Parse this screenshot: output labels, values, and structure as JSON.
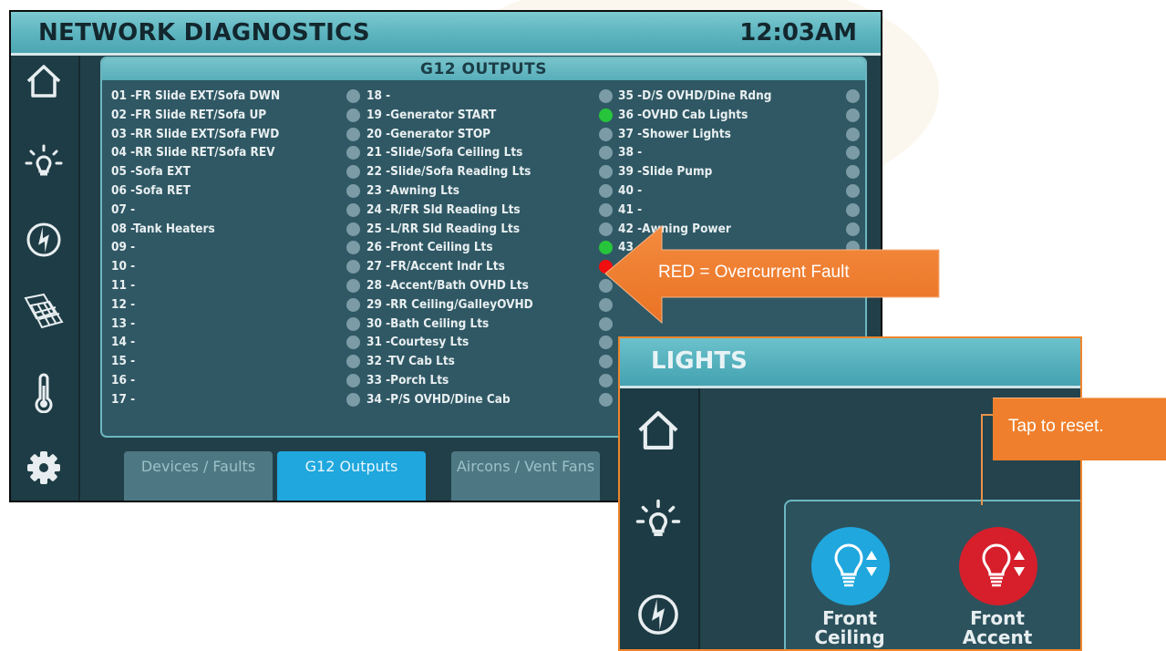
{
  "colors": {
    "accent": "#4ca6b2",
    "active_tab": "#1fa7de",
    "led_off": "#7b9ba6",
    "led_on": "#27c53b",
    "led_fault": "#f10e0e",
    "callout": "#ef7f2c"
  },
  "header": {
    "title": "NETWORK DIAGNOSTICS",
    "time": "12:03AM"
  },
  "sidebar": {
    "items": [
      {
        "icon": "home-icon"
      },
      {
        "icon": "light-bulb-icon"
      },
      {
        "icon": "power-icon"
      },
      {
        "icon": "solar-panel-icon"
      },
      {
        "icon": "thermometer-icon"
      },
      {
        "icon": "gear-icon"
      }
    ]
  },
  "outputs": {
    "title": "G12 OUTPUTS",
    "columns": [
      [
        {
          "label": "01 -FR Slide EXT/Sofa DWN",
          "state": "off"
        },
        {
          "label": "02 -FR Slide RET/Sofa UP",
          "state": "off"
        },
        {
          "label": "03 -RR Slide EXT/Sofa FWD",
          "state": "off"
        },
        {
          "label": "04 -RR Slide RET/Sofa REV",
          "state": "off"
        },
        {
          "label": "05 -Sofa EXT",
          "state": "off"
        },
        {
          "label": "06 -Sofa RET",
          "state": "off"
        },
        {
          "label": "07 -",
          "state": "off"
        },
        {
          "label": "08 -Tank Heaters",
          "state": "off"
        },
        {
          "label": "09 -",
          "state": "off"
        },
        {
          "label": "10 -",
          "state": "off"
        },
        {
          "label": "11 -",
          "state": "off"
        },
        {
          "label": "12 -",
          "state": "off"
        },
        {
          "label": "13 -",
          "state": "off"
        },
        {
          "label": "14 -",
          "state": "off"
        },
        {
          "label": "15 -",
          "state": "off"
        },
        {
          "label": "16 -",
          "state": "off"
        },
        {
          "label": "17 -",
          "state": "off"
        }
      ],
      [
        {
          "label": "18 -",
          "state": "off"
        },
        {
          "label": "19 -Generator START",
          "state": "on"
        },
        {
          "label": "20 -Generator STOP",
          "state": "off"
        },
        {
          "label": "21 -Slide/Sofa Ceiling Lts",
          "state": "off"
        },
        {
          "label": "22 -Slide/Sofa Reading Lts",
          "state": "off"
        },
        {
          "label": "23 -Awning Lts",
          "state": "off"
        },
        {
          "label": "24 -R/FR Sld Reading Lts",
          "state": "off"
        },
        {
          "label": "25 -L/RR Sld Reading Lts",
          "state": "off"
        },
        {
          "label": "26 -Front Ceiling Lts",
          "state": "on"
        },
        {
          "label": "27 -FR/Accent Indr Lts",
          "state": "fault"
        },
        {
          "label": "28 -Accent/Bath OVHD Lts",
          "state": "off"
        },
        {
          "label": "29 -RR Ceiling/GalleyOVHD",
          "state": "off"
        },
        {
          "label": "30 -Bath Ceiling Lts",
          "state": "off"
        },
        {
          "label": "31 -Courtesy Lts",
          "state": "off"
        },
        {
          "label": "32 -TV Cab Lts",
          "state": "off"
        },
        {
          "label": "33 -Porch Lts",
          "state": "off"
        },
        {
          "label": "34 -P/S OVHD/Dine Cab",
          "state": "off"
        }
      ],
      [
        {
          "label": "35 -D/S OVHD/Dine Rdng",
          "state": "off"
        },
        {
          "label": "36 -OVHD Cab Lights",
          "state": "off"
        },
        {
          "label": "37 -Shower Lights",
          "state": "off"
        },
        {
          "label": "38 -",
          "state": "off"
        },
        {
          "label": "39 -Slide Pump",
          "state": "off"
        },
        {
          "label": "40 -",
          "state": "off"
        },
        {
          "label": "41 -",
          "state": "off"
        },
        {
          "label": "42 -Awning Power",
          "state": "off"
        },
        {
          "label": "43 -",
          "state": "off"
        }
      ]
    ]
  },
  "tabs": [
    {
      "label": "Devices / Faults",
      "active": false
    },
    {
      "label": "G12 Outputs",
      "active": true
    },
    {
      "label": "Aircons / Vent Fans",
      "active": false
    }
  ],
  "callouts": {
    "fault": "RED = Overcurrent Fault",
    "reset": "Tap to reset."
  },
  "lights": {
    "title": "LIGHTS",
    "buttons": [
      {
        "label_line1": "Front",
        "label_line2": "Ceiling",
        "color": "#1fa7de",
        "icon": "light-bulb-dimmer-icon"
      },
      {
        "label_line1": "Front",
        "label_line2": "Accent",
        "color": "#d61f2b",
        "icon": "light-bulb-dimmer-icon"
      }
    ]
  }
}
